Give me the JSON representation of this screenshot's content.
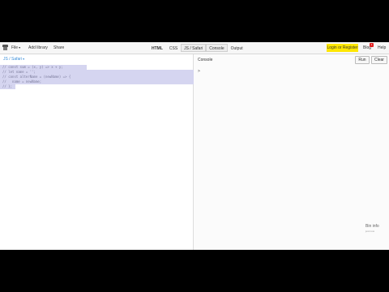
{
  "menu": {
    "file": "File",
    "add_library": "Add library",
    "share": "Share"
  },
  "tabs": [
    {
      "label": "HTML"
    },
    {
      "label": "CSS"
    },
    {
      "label": "JS / Safari"
    },
    {
      "label": "Console"
    },
    {
      "label": "Output"
    }
  ],
  "header_right": {
    "login": "Login or Register",
    "blog": "Blog",
    "blog_badge": "1",
    "help": "Help",
    "accent_color": "#ffe700"
  },
  "editor": {
    "title": "JS / Safari",
    "lines": [
      "// const sum = (x, y) => x + y;",
      "// let name = '';",
      "// const alterName = (newName) => {",
      "//   name = newName;",
      "// };"
    ]
  },
  "console": {
    "title": "Console",
    "run": "Run",
    "clear": "Clear",
    "prompt": ">"
  },
  "bin_info": {
    "title": "Bin info",
    "subtitle": "just now"
  }
}
